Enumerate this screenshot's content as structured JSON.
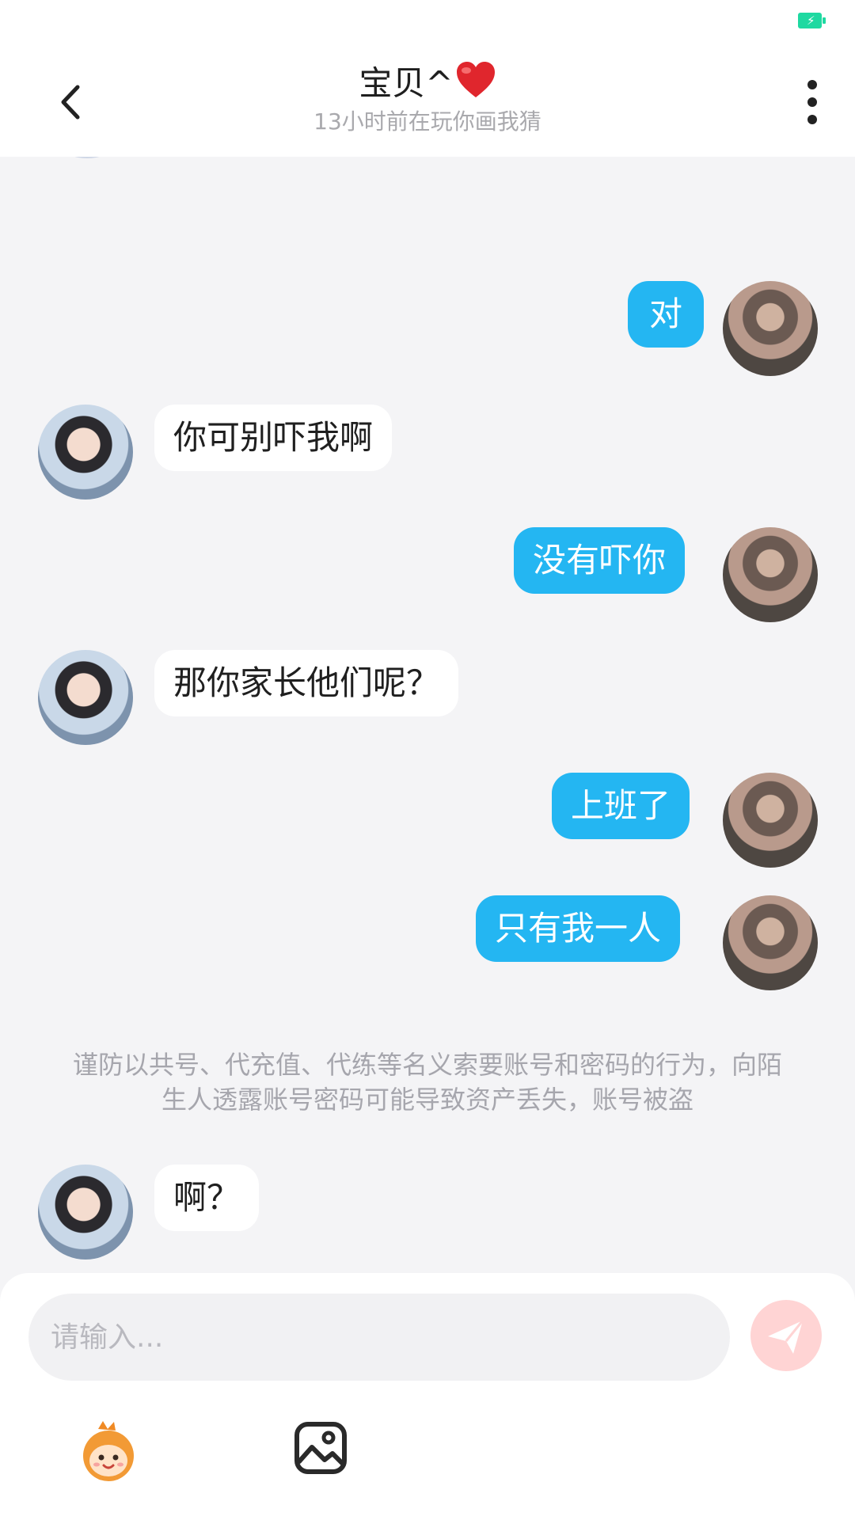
{
  "header": {
    "title": "宝贝^",
    "subtitle": "13小时前在玩你画我猜",
    "back_icon": "chevron-left-icon",
    "menu_icon": "more-vertical-icon"
  },
  "messages": [
    {
      "from": "self",
      "text": "对"
    },
    {
      "from": "other",
      "text": "你可别吓我啊"
    },
    {
      "from": "self",
      "text": "没有吓你"
    },
    {
      "from": "other",
      "text": "那你家长他们呢？"
    },
    {
      "from": "self",
      "text": "上班了"
    },
    {
      "from": "self",
      "text": "只有我一人"
    },
    {
      "from": "other",
      "text": "啊？"
    }
  ],
  "notice": "谨防以共号、代充值、代练等名义索要账号和密码的行为，向陌生人透露账号密码可能导致资产丢失，账号被盗",
  "composer": {
    "placeholder": "请输入...",
    "send_icon": "send-icon",
    "emoji_icon": "emoji-sticker-icon",
    "image_icon": "image-icon"
  },
  "colors": {
    "self_bubble": "#24b6f2",
    "other_bubble": "#ffffff",
    "battery": "#1fd9a1",
    "send_disabled": "#ffd4d4"
  }
}
